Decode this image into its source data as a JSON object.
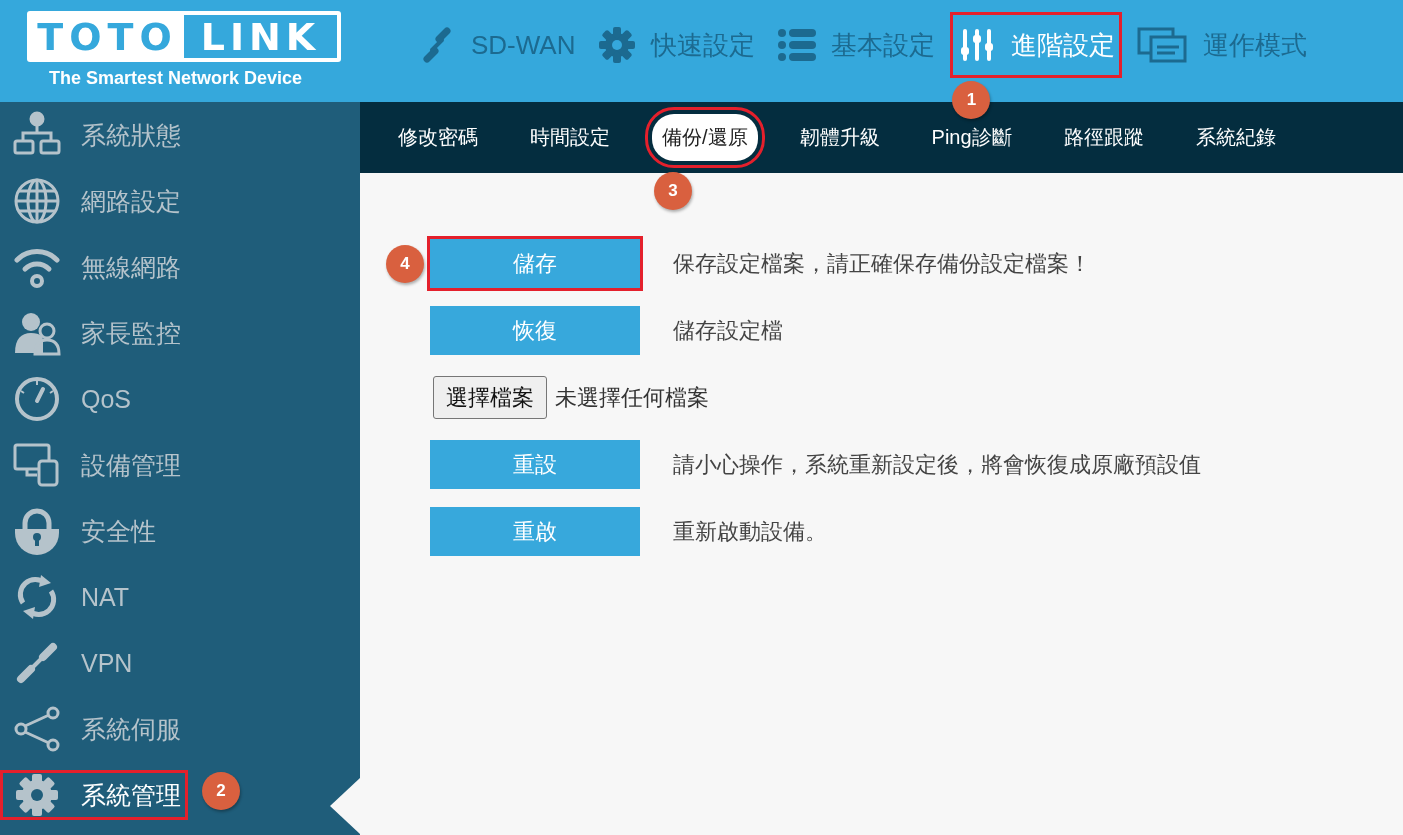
{
  "logo": {
    "word_1": "TOTO",
    "word_2": "LINK",
    "tagline": "The Smartest Network Device"
  },
  "nav": [
    {
      "label": "SD-WAN",
      "selected": false,
      "highlighted": false
    },
    {
      "label": "快速設定",
      "selected": false,
      "highlighted": false
    },
    {
      "label": "基本設定",
      "selected": false,
      "highlighted": false
    },
    {
      "label": "進階設定",
      "selected": true,
      "highlighted": true,
      "callout": "1"
    },
    {
      "label": "運作模式",
      "selected": false,
      "highlighted": false
    }
  ],
  "sidebar": {
    "items": [
      {
        "label": "系統狀態",
        "selected": false,
        "highlighted": false
      },
      {
        "label": "網路設定",
        "selected": false,
        "highlighted": false
      },
      {
        "label": "無線網路",
        "selected": false,
        "highlighted": false
      },
      {
        "label": "家長監控",
        "selected": false,
        "highlighted": false
      },
      {
        "label": "QoS",
        "selected": false,
        "highlighted": false
      },
      {
        "label": "設備管理",
        "selected": false,
        "highlighted": false
      },
      {
        "label": "安全性",
        "selected": false,
        "highlighted": false
      },
      {
        "label": "NAT",
        "selected": false,
        "highlighted": false
      },
      {
        "label": "VPN",
        "selected": false,
        "highlighted": false
      },
      {
        "label": "系統伺服",
        "selected": false,
        "highlighted": false
      },
      {
        "label": "系統管理",
        "selected": true,
        "highlighted": true,
        "callout": "2"
      }
    ]
  },
  "tabs": [
    {
      "label": "修改密碼",
      "selected": false,
      "highlighted": false
    },
    {
      "label": "時間設定",
      "selected": false,
      "highlighted": false
    },
    {
      "label": "備份/還原",
      "selected": true,
      "highlighted": true,
      "callout": "3"
    },
    {
      "label": "韌體升級",
      "selected": false,
      "highlighted": false
    },
    {
      "label": "Ping診斷",
      "selected": false,
      "highlighted": false
    },
    {
      "label": "路徑跟蹤",
      "selected": false,
      "highlighted": false
    },
    {
      "label": "系統紀錄",
      "selected": false,
      "highlighted": false
    }
  ],
  "actions": [
    {
      "kind": "button",
      "label": "儲存",
      "description": "保存設定檔案，請正確保存備份設定檔案！",
      "highlighted": true,
      "callout": "4"
    },
    {
      "kind": "button",
      "label": "恢復",
      "description": "儲存設定檔",
      "highlighted": false
    },
    {
      "kind": "file",
      "label": "選擇檔案",
      "description": "未選擇任何檔案"
    },
    {
      "kind": "button",
      "label": "重設",
      "description": "請小心操作，系統重新設定後，將會恢復成原廠預設值",
      "highlighted": false
    },
    {
      "kind": "button",
      "label": "重啟",
      "description": "重新啟動設備。",
      "highlighted": false
    }
  ]
}
